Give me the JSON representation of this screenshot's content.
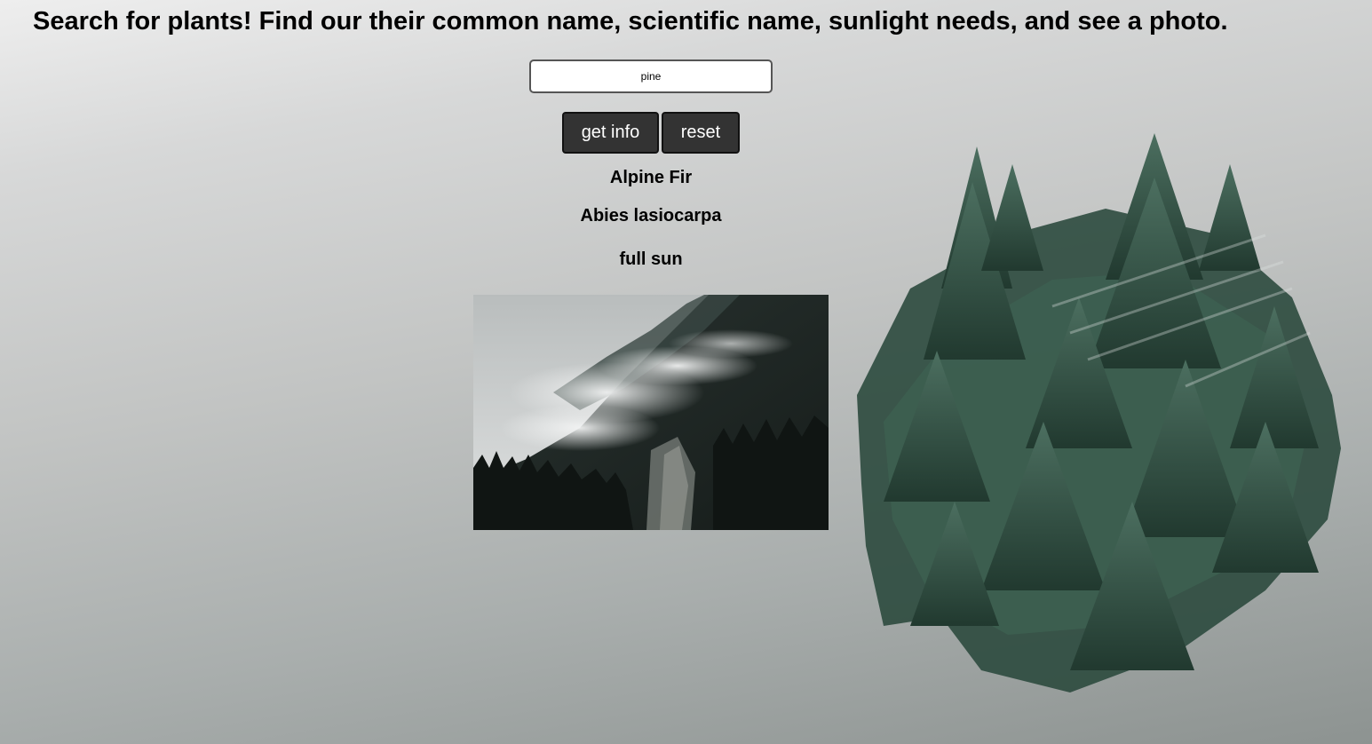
{
  "header": {
    "title": "Search for plants! Find our their common name, scientific name, sunlight needs, and see a photo."
  },
  "search": {
    "value": "pine"
  },
  "buttons": {
    "get_info": "get info",
    "reset": "reset"
  },
  "result": {
    "common_name": "Alpine Fir",
    "scientific_name": "Abies lasiocarpa",
    "sunlight": "full sun"
  },
  "colors": {
    "button_bg": "#333333",
    "button_text": "#ffffff",
    "forest_green": "#2f5244"
  },
  "images": {
    "plant_photo": "misty-forest-mountain-photo",
    "decoration": "pine-trees-brushstroke-art"
  }
}
